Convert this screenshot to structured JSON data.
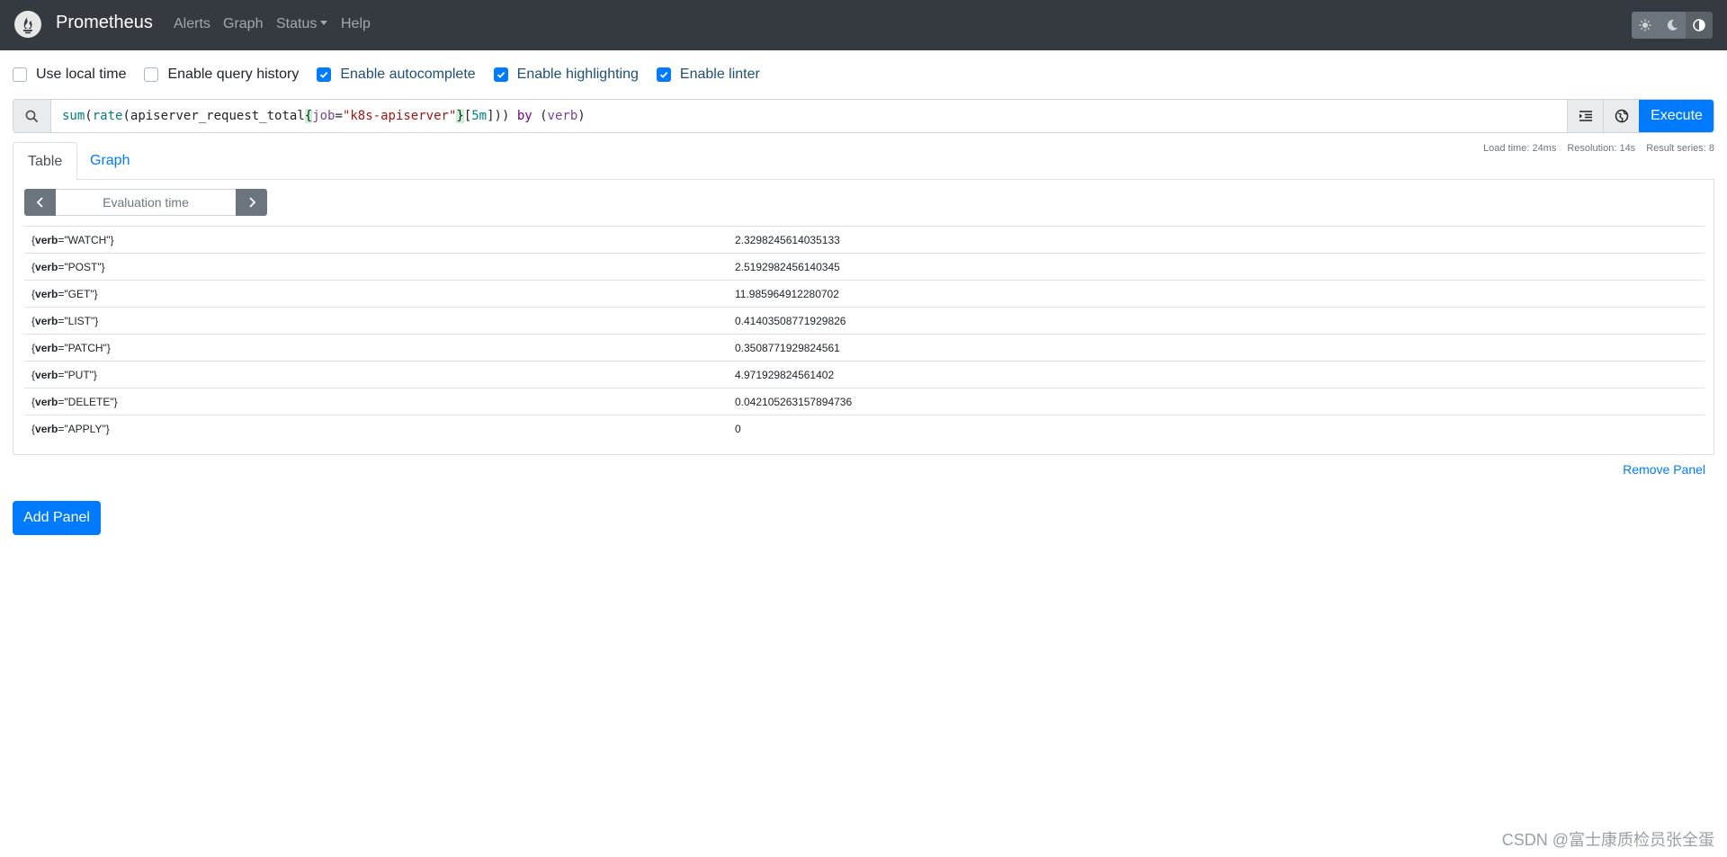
{
  "navbar": {
    "brand": "Prometheus",
    "items": [
      {
        "label": "Alerts"
      },
      {
        "label": "Graph"
      },
      {
        "label": "Status"
      },
      {
        "label": "Help"
      }
    ]
  },
  "options": {
    "use_local_time": {
      "label": "Use local time",
      "checked": false
    },
    "enable_query_history": {
      "label": "Enable query history",
      "checked": false
    },
    "enable_autocomplete": {
      "label": "Enable autocomplete",
      "checked": true
    },
    "enable_highlighting": {
      "label": "Enable highlighting",
      "checked": true
    },
    "enable_linter": {
      "label": "Enable linter",
      "checked": true
    }
  },
  "query": {
    "fn1": "sum",
    "fn2": "rate",
    "metric": "apiserver_request_total",
    "label_name": "job",
    "label_value": "\"k8s-apiserver\"",
    "duration": "5m",
    "keyword": "by",
    "group_label": "verb",
    "execute_label": "Execute"
  },
  "stats": {
    "load_time": "Load time: 24ms",
    "resolution": "Resolution: 14s",
    "result_series": "Result series: 8"
  },
  "tabs": {
    "table": "Table",
    "graph": "Graph"
  },
  "eval": {
    "placeholder": "Evaluation time"
  },
  "results": {
    "rows": [
      {
        "key": "verb",
        "value_label": "\"WATCH\"",
        "value": "2.3298245614035133"
      },
      {
        "key": "verb",
        "value_label": "\"POST\"",
        "value": "2.5192982456140345"
      },
      {
        "key": "verb",
        "value_label": "\"GET\"",
        "value": "11.985964912280702"
      },
      {
        "key": "verb",
        "value_label": "\"LIST\"",
        "value": "0.41403508771929826"
      },
      {
        "key": "verb",
        "value_label": "\"PATCH\"",
        "value": "0.3508771929824561"
      },
      {
        "key": "verb",
        "value_label": "\"PUT\"",
        "value": "4.971929824561402"
      },
      {
        "key": "verb",
        "value_label": "\"DELETE\"",
        "value": "0.042105263157894736"
      },
      {
        "key": "verb",
        "value_label": "\"APPLY\"",
        "value": "0"
      }
    ]
  },
  "actions": {
    "remove_panel": "Remove Panel",
    "add_panel": "Add Panel"
  },
  "watermark": "CSDN @富士康质检员张全蛋",
  "colors": {
    "navbar": "#343a40",
    "primary": "#007bff",
    "secondary": "#6c757d"
  }
}
